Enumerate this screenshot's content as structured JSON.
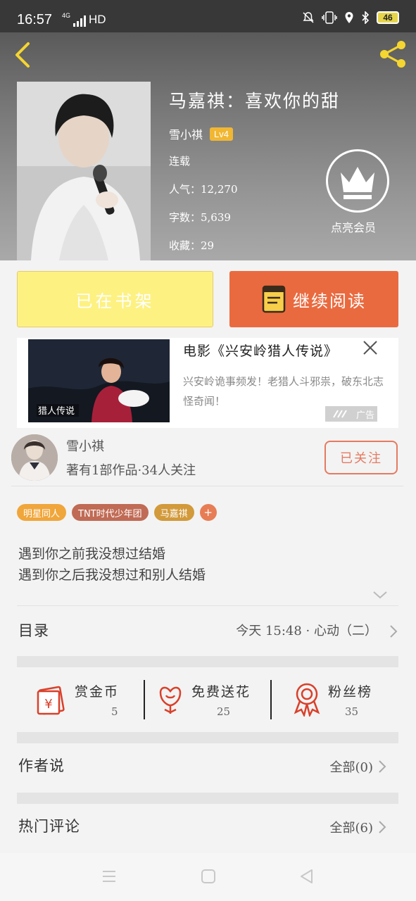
{
  "status_bar": {
    "time": "16:57",
    "network": "4G",
    "network_extra": "HD",
    "battery": "46"
  },
  "book": {
    "title": "马嘉祺：喜欢你的甜",
    "author": "雪小祺",
    "level": "Lv4",
    "status": "连载",
    "popularity": "人气：12,270",
    "word_count": "字数：5,639",
    "favorites": "收藏：29"
  },
  "vip": {
    "label": "点亮会员"
  },
  "actions": {
    "shelf_label": "已在书架",
    "read_label": "继续阅读"
  },
  "ad": {
    "title": "电影《兴安岭猎人传说》",
    "description": "兴安岭诡事频发！老猎人斗邪祟，破东北志怪奇闻！",
    "tag": "广告",
    "poster_text": "猎人传说"
  },
  "author_card": {
    "name": "雪小祺",
    "stats": "著有1部作品·34人关注",
    "follow_label": "已关注"
  },
  "tags": [
    {
      "label": "明星同人",
      "color": "#f0a63b"
    },
    {
      "label": "TNT时代少年团",
      "color": "#c06b55"
    },
    {
      "label": "马嘉祺",
      "color": "#d29a3a"
    }
  ],
  "tag_more": "+",
  "synopsis": {
    "line1": "遇到你之前我没想过结婚",
    "line2": "遇到你之后我没想过和别人结婚"
  },
  "catalog": {
    "label": "目录",
    "latest": "今天 15:48 · 心动（二）"
  },
  "stats": [
    {
      "title": "赏金币",
      "value": "5",
      "icon": "red-envelope-icon"
    },
    {
      "title": "免费送花",
      "value": "25",
      "icon": "flower-icon"
    },
    {
      "title": "粉丝榜",
      "value": "35",
      "icon": "medal-icon"
    }
  ],
  "author_says": {
    "label": "作者说",
    "count": "全部(0)"
  },
  "hot_comments": {
    "label": "热门评论",
    "count": "全部(6)"
  },
  "colors": {
    "accent_orange": "#ea6a3f",
    "shelf_yellow": "#fdf182",
    "icon_red": "#d9402a",
    "share_yellow": "#f5d530"
  }
}
